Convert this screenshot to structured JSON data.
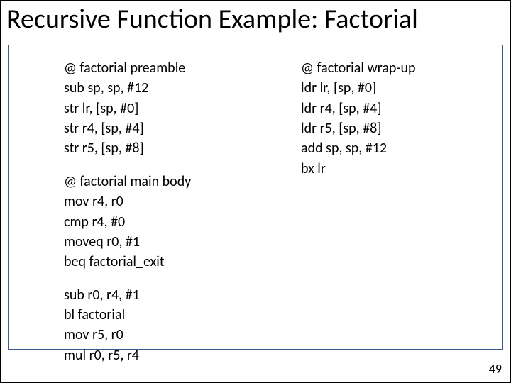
{
  "title": "Recursive Function Example: Factorial",
  "page_number": "49",
  "left": {
    "block1": {
      "l0": "@ factorial preamble",
      "l1": "sub sp, sp, #12",
      "l2": "str lr, [sp, #0]",
      "l3": "str r4, [sp, #4]",
      "l4": "str r5, [sp, #8]"
    },
    "block2": {
      "l0": "@ factorial main body",
      "l1": "mov r4, r0",
      "l2": "cmp r4, #0",
      "l3": "moveq r0, #1",
      "l4": "beq factorial_exit"
    },
    "block3": {
      "l0": "sub r0, r4, #1",
      "l1": "bl factorial",
      "l2": "mov r5, r0",
      "l3": "mul r0, r5, r4"
    }
  },
  "right": {
    "block1": {
      "l0": "@ factorial wrap-up",
      "l1": "ldr lr, [sp, #0]",
      "l2": "ldr r4, [sp, #4]",
      "l3": "ldr r5, [sp, #8]",
      "l4": "add sp, sp, #12",
      "l5": "bx lr"
    }
  }
}
